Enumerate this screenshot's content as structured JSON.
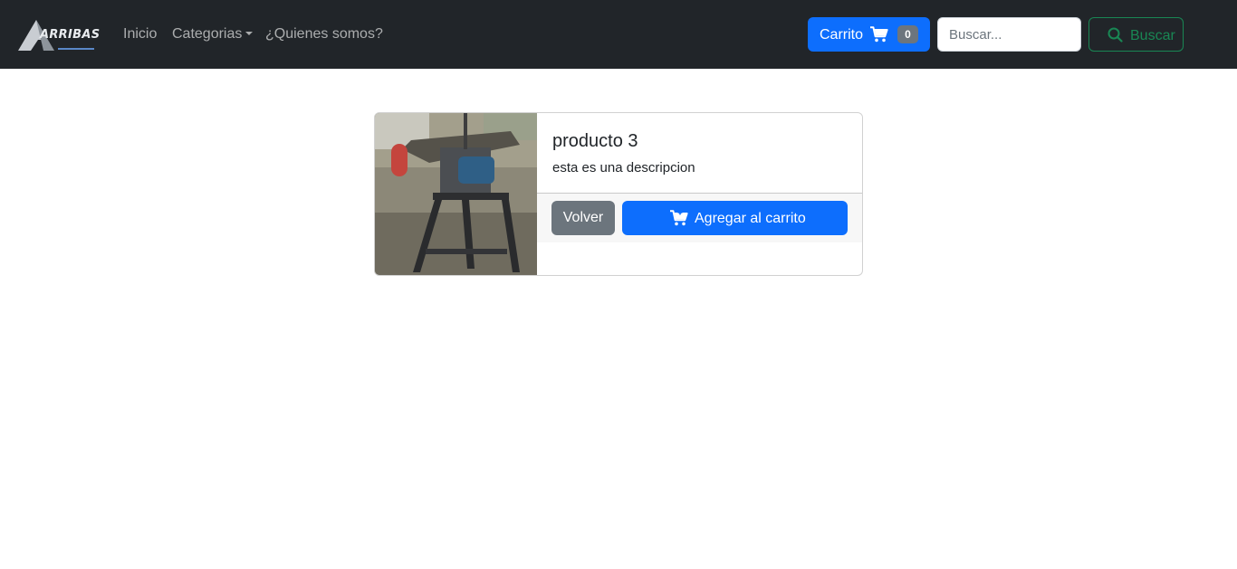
{
  "navbar": {
    "brand": "ARRIBAS",
    "links": {
      "inicio": "Inicio",
      "categorias": "Categorias",
      "quienes": "¿Quienes somos?"
    },
    "cart": {
      "label": "Carrito",
      "count": "0",
      "icon": "shopping-cart-icon"
    },
    "search": {
      "placeholder": "Buscar...",
      "value": "",
      "button_label": "Buscar",
      "icon": "search-icon"
    }
  },
  "product": {
    "title": "producto 3",
    "description": "esta es una descripcion",
    "image": "belt-grinder-machine-photo",
    "back_label": "Volver",
    "add_label": "Agregar al carrito",
    "add_icon": "shopping-cart-plus-icon"
  },
  "colors": {
    "navbar_bg": "#212529",
    "primary": "#0d6efd",
    "secondary": "#6c757d",
    "success": "#198754"
  }
}
